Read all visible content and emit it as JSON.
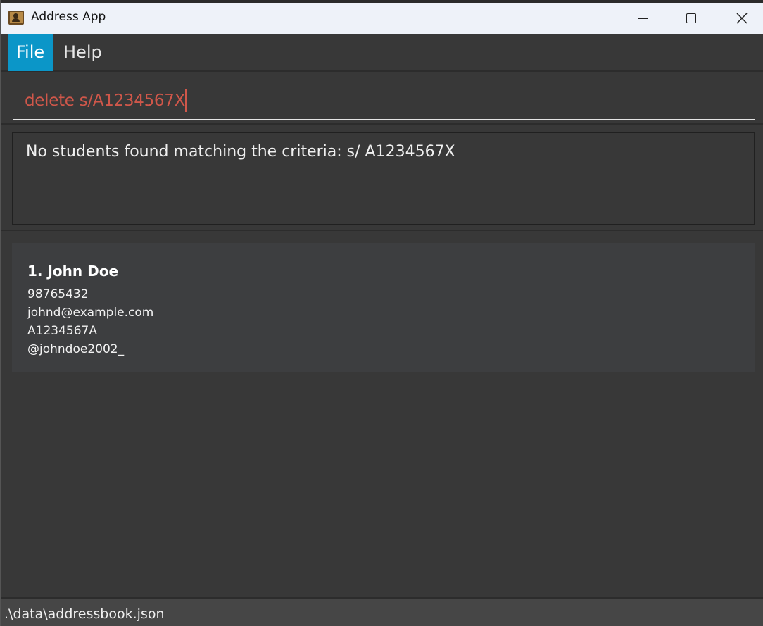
{
  "window": {
    "title": "Address App",
    "icon": "address-book-icon"
  },
  "menu": {
    "items": [
      {
        "label": "File",
        "active": true
      },
      {
        "label": "Help",
        "active": false
      }
    ]
  },
  "command": {
    "value": "delete s/A1234567X",
    "text_color": "#d0574a"
  },
  "result": {
    "message": "No students found matching the criteria: s/ A1234567X"
  },
  "person_list": [
    {
      "index_name": "1. John Doe",
      "phone": "98765432",
      "email": "johnd@example.com",
      "student_id": "A1234567A",
      "handle": "@johndoe2002_"
    }
  ],
  "status_bar": {
    "path": ".\\data\\addressbook.json"
  },
  "colors": {
    "accent": "#0b96c8",
    "background": "#383838",
    "card": "#3d3e40",
    "error_text": "#d0574a"
  }
}
